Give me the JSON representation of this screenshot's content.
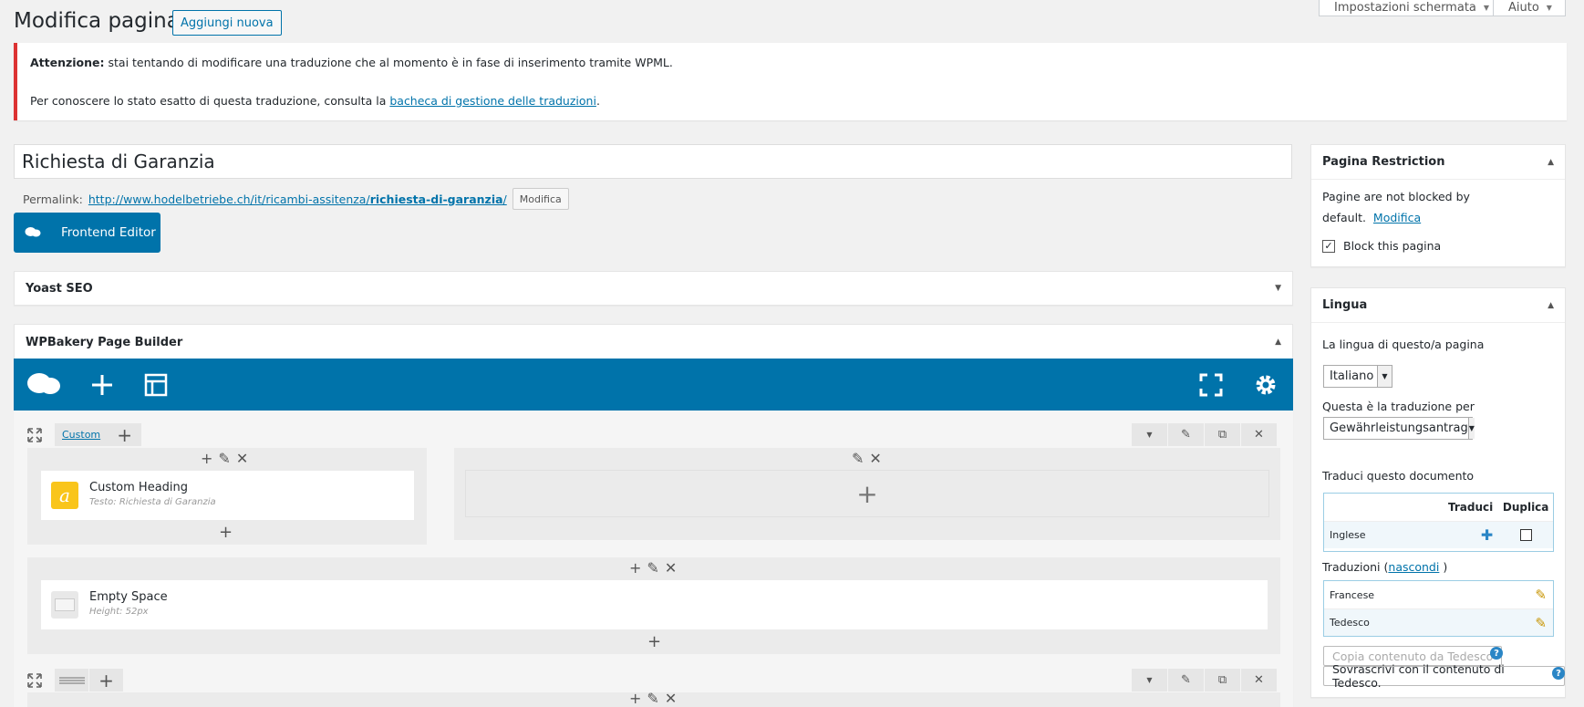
{
  "header": {
    "title": "Modifica pagina",
    "add_new": "Aggiungi nuova",
    "screen_options": "Impostazioni schermata",
    "help": "Aiuto"
  },
  "notice": {
    "strong": "Attenzione:",
    "line1": " stai tentando di modificare una traduzione che al momento è in fase di inserimento tramite WPML.",
    "line2_prefix": "Per conoscere lo stato esatto di questa traduzione, consulta la ",
    "line2_link": "bacheca di gestione delle traduzioni",
    "line2_suffix": "."
  },
  "post": {
    "title": "Richiesta di Garanzia",
    "permalink_label": "Permalink:",
    "permalink_base": "http://www.hodelbetriebe.ch/it/ricambi-assitenza/",
    "permalink_slug": "richiesta-di-garanzia",
    "permalink_end": "/",
    "permalink_edit": "Modifica",
    "frontend_editor": "Frontend Editor"
  },
  "boxes": {
    "yoast": "Yoast SEO",
    "wpbakery": "WPBakery Page Builder"
  },
  "builder": {
    "row1_tab": "Custom",
    "heading_title": "Custom Heading",
    "heading_sub": "Testo: Richiesta di Garanzia",
    "space_title": "Empty Space",
    "space_sub": "Height: 52px"
  },
  "restriction": {
    "title": "Pagina Restriction",
    "text_a": "Pagine are not blocked by",
    "text_b": "default.",
    "link": "Modifica",
    "checkbox_label": "Block this pagina"
  },
  "language": {
    "title": "Lingua",
    "lang_label": "La lingua di questo/a pagina",
    "lang_value": "Italiano",
    "translation_of_label": "Questa è la traduzione per",
    "translation_of_value": "Gewährleistungsantrag",
    "translate_doc_label": "Traduci questo documento",
    "col_translate": "Traduci",
    "col_duplicate": "Duplica",
    "row_lang": "Inglese",
    "translations_label": "Traduzioni (",
    "translations_link": "nascondi",
    "translations_end": " )",
    "tr1": "Francese",
    "tr2": "Tedesco",
    "copy_btn": "Copia contenuto da Tedesco",
    "overwrite_btn": "Sovrascrivi con il contenuto di Tedesco."
  },
  "colors": {
    "accent": "#0073aa",
    "notice_error": "#dc3232",
    "heading_icon": "#f9c51b"
  }
}
